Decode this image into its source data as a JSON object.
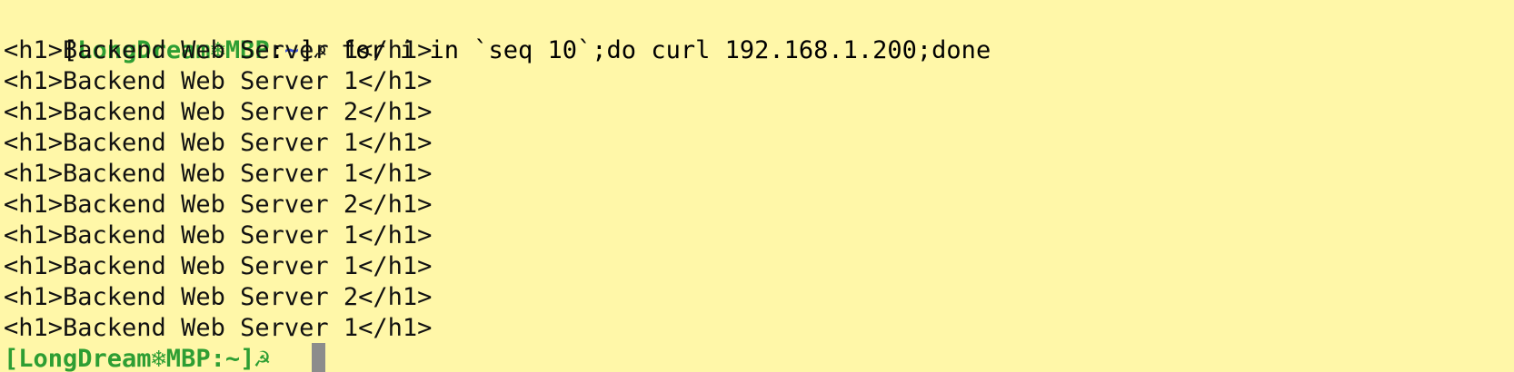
{
  "prompt": {
    "open_bracket": "[",
    "user": "LongDream",
    "separator": "❄",
    "host": "MBP",
    "colon": ":",
    "cwd": "~",
    "close_bracket": "]",
    "glyph": "☭",
    "command": " for i in `seq 10`;do curl 192.168.1.200;done"
  },
  "output": [
    "<h1>Backend Web Server 1</h1>",
    "<h1>Backend Web Server 1</h1>",
    "<h1>Backend Web Server 2</h1>",
    "<h1>Backend Web Server 1</h1>",
    "<h1>Backend Web Server 1</h1>",
    "<h1>Backend Web Server 2</h1>",
    "<h1>Backend Web Server 1</h1>",
    "<h1>Backend Web Server 1</h1>",
    "<h1>Backend Web Server 2</h1>",
    "<h1>Backend Web Server 1</h1>"
  ],
  "next_prompt": "[LongDream❄MBP:~]☭ ",
  "colors": {
    "background": "#fff7a8",
    "user": "#2e9e33",
    "cwd": "#3f51d4",
    "cursor": "#8c8c8c"
  }
}
